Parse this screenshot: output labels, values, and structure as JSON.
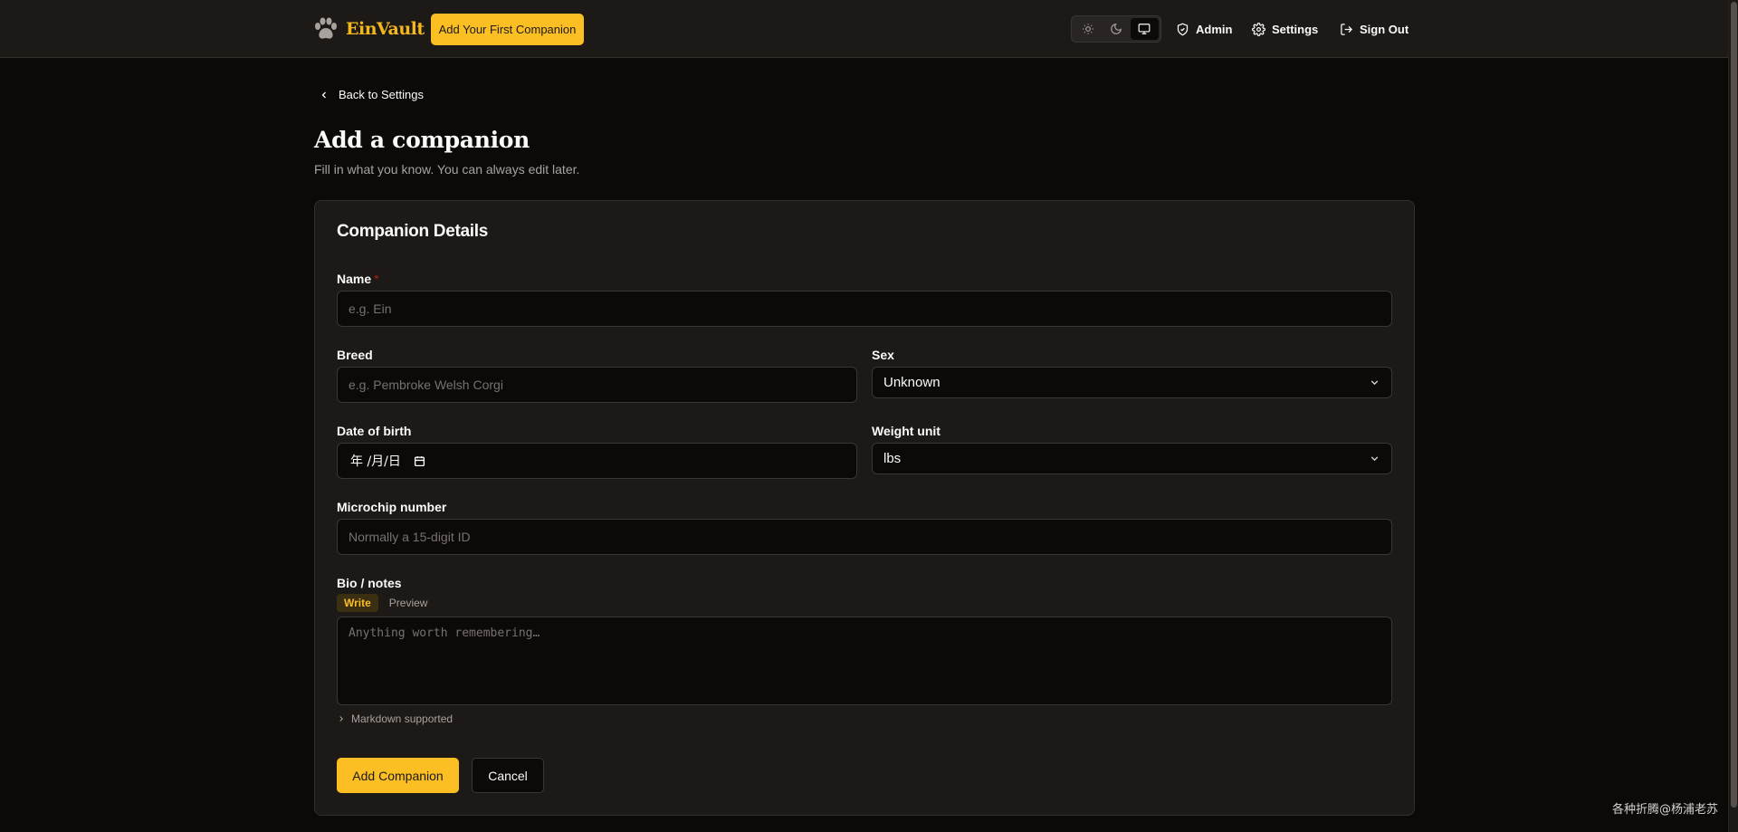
{
  "header": {
    "brand": "EinVault",
    "cta_label": "Add Your First Companion",
    "theme_options": [
      "light",
      "dark",
      "system"
    ],
    "theme_selected": "system",
    "nav": {
      "admin": "Admin",
      "settings": "Settings",
      "sign_out": "Sign Out"
    }
  },
  "page": {
    "back_label": "Back to Settings",
    "title": "Add a companion",
    "subtitle": "Fill in what you know. You can always edit later."
  },
  "form": {
    "card_title": "Companion Details",
    "name": {
      "label": "Name",
      "required_mark": "*",
      "placeholder": "e.g. Ein",
      "value": ""
    },
    "breed": {
      "label": "Breed",
      "placeholder": "e.g. Pembroke Welsh Corgi",
      "value": ""
    },
    "sex": {
      "label": "Sex",
      "selected": "Unknown"
    },
    "dob": {
      "label": "Date of birth",
      "display": "年 /月/日"
    },
    "weight_unit": {
      "label": "Weight unit",
      "selected": "lbs"
    },
    "microchip": {
      "label": "Microchip number",
      "placeholder": "Normally a 15-digit ID",
      "value": ""
    },
    "bio": {
      "label": "Bio / notes",
      "tabs": [
        "Write",
        "Preview"
      ],
      "active_tab": "Write",
      "placeholder": "Anything worth remembering…",
      "value": "",
      "hint": "Markdown supported"
    },
    "submit_label": "Add Companion",
    "cancel_label": "Cancel"
  },
  "watermark": "各种折腾@杨浦老苏",
  "colors": {
    "background": "#0c0a09",
    "surface": "#1c1917",
    "accent": "#fbbf24",
    "brand": "#f4b81e",
    "required": "#b91c1c",
    "muted_text": "#a8a29e"
  }
}
